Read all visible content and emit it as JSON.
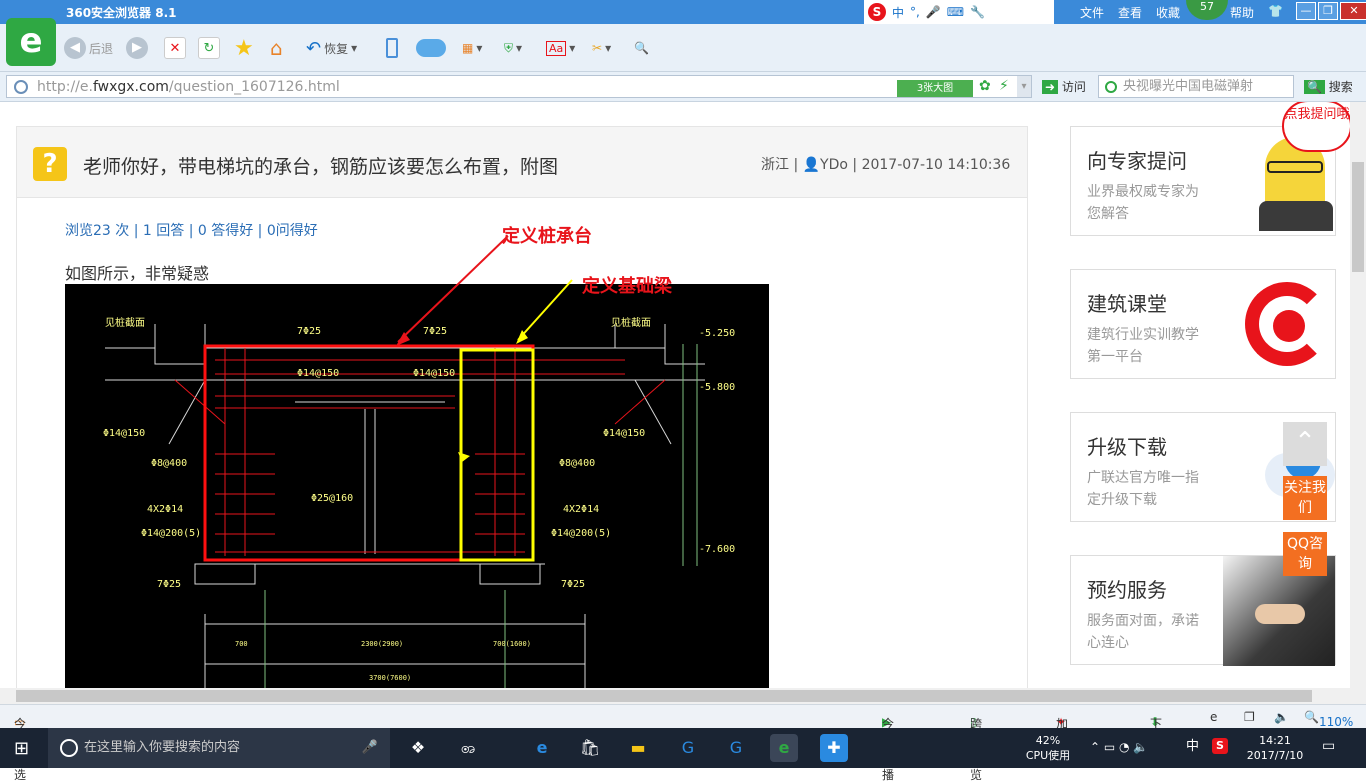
{
  "browser": {
    "title": "360安全浏览器 8.1",
    "menu": [
      "文件",
      "查看",
      "收藏",
      "帮助"
    ],
    "badge": "57",
    "ime_label": "中",
    "toolbar": {
      "back": "后退",
      "restore": "恢复"
    },
    "url_prefix": "http://e.",
    "url_domain": "fwxgx.com",
    "url_path": "/question_1607126.html",
    "big_image_btn": "3张大图",
    "visit_label": "访问",
    "search_placeholder": "央视曝光中国电磁弹射",
    "search_label": "搜索"
  },
  "question": {
    "title": "老师你好，带电梯坑的承台，钢筋应该要怎么布置，附图",
    "meta": "浙江 | 👤YDo | 2017-07-10 14:10:36",
    "stats": "浏览23 次 | 1 回答 | 0 答得好 | 0问得好",
    "description": "如图所示，非常疑惑",
    "annotation_red": "定义桩承台",
    "annotation_yellow": "定义基础梁"
  },
  "cad": {
    "labels": {
      "top_left": "见桩截面",
      "top_right": "见桩截面",
      "bar_7_25": "7Φ25",
      "bar_14_150": "Φ14@150",
      "bar_8_400": "Φ8@400",
      "bar_4x2": "4X2Φ14",
      "bar_14_200": "Φ14@200(5)",
      "bar_25_160": "Φ25@160",
      "elev_1": "-5.250",
      "elev_2": "-5.800",
      "elev_3": "-7.600",
      "dim_1": "2300(2900)",
      "dim_2": "3700(7600)",
      "dim_3": "700",
      "dim_4": "700(1600)"
    }
  },
  "sidebar": [
    {
      "title": "向专家提问",
      "desc": "业界最权威专家为您解答",
      "bubble": "点我提问哦"
    },
    {
      "title": "建筑课堂",
      "desc": "建筑行业实训教学第一平台"
    },
    {
      "title": "升级下载",
      "desc": "广联达官方唯一指定升级下载"
    },
    {
      "title": "预约服务",
      "desc": "服务面对面，承诺心连心"
    }
  ],
  "float_buttons": {
    "follow": "关注我们",
    "qq": "QQ咨询"
  },
  "statusbar": {
    "today": "今日优选",
    "live": "今日直播",
    "cross": "跨屏浏览",
    "accel": "加速器",
    "download": "下载",
    "zoom": "110%"
  },
  "taskbar": {
    "search_placeholder": "在这里输入你要搜索的内容",
    "cpu_pct": "42%",
    "cpu_label": "CPU使用",
    "ime": "中",
    "time": "14:21",
    "date": "2017/7/10"
  },
  "colors": {
    "accent": "#2fa843",
    "link": "#2a6db5",
    "float": "#f36f21"
  }
}
